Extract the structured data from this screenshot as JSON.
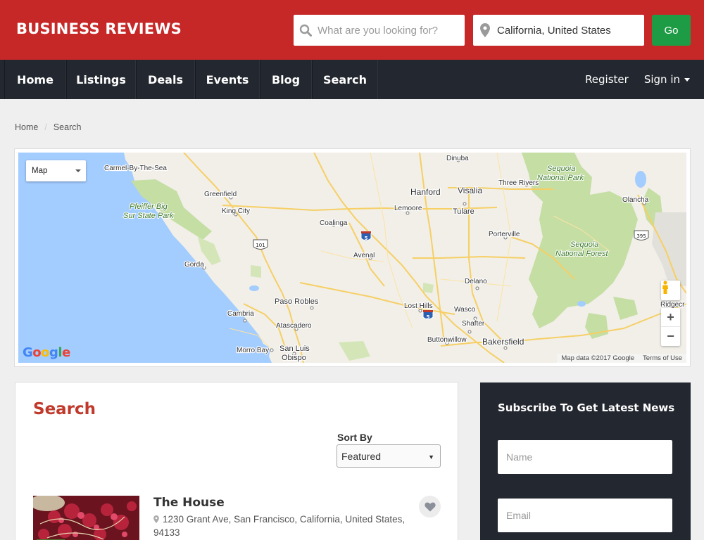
{
  "header": {
    "logo": "BUSINESS REVIEWS",
    "what_placeholder": "What are you looking for?",
    "where_value": "California, United States",
    "go_label": "Go",
    "brand_color": "#c62828",
    "go_color": "#1e9b45"
  },
  "nav": {
    "items": [
      {
        "label": "Home"
      },
      {
        "label": "Listings"
      },
      {
        "label": "Deals"
      },
      {
        "label": "Events"
      },
      {
        "label": "Blog"
      },
      {
        "label": "Search"
      }
    ],
    "register": "Register",
    "signin": "Sign in"
  },
  "breadcrumb": {
    "home": "Home",
    "current": "Search"
  },
  "map": {
    "type_label": "Map",
    "places": {
      "carmel": "Carmel-By-The-Sea",
      "dinuba": "Dinuba",
      "sequoia_np": "Sequoia",
      "sequoia_np2": "National Park",
      "three_rivers": "Three Rivers",
      "greenfield": "Greenfield",
      "hanford": "Hanford",
      "visalia": "Visalia",
      "pfeiffer1": "Pfeiffer Big",
      "pfeiffer2": "Sur State Park",
      "king_city": "King City",
      "lemoore": "Lemoore",
      "tulare": "Tulare",
      "olancha": "Olancha",
      "coalinga": "Coalinga",
      "porterville": "Porterville",
      "sequoia_nf": "Sequoia",
      "sequoia_nf2": "National Forest",
      "avenal": "Avenal",
      "gorda": "Gorda",
      "delano": "Delano",
      "ridgecrest": "Ridgecr",
      "paso_robles": "Paso Robles",
      "lost_hills": "Lost Hills",
      "cambria": "Cambria",
      "wasco": "Wasco",
      "atascadero": "Atascadero",
      "shafter": "Shafter",
      "buttonwillow": "Buttonwillow",
      "bakersfield": "Bakersfield",
      "morro_bay": "Morro Bay",
      "san_luis1": "San Luis",
      "san_luis2": "Obispo"
    },
    "shields": {
      "i5": "5",
      "us101": "101",
      "us395": "395"
    },
    "google": [
      "G",
      "o",
      "o",
      "g",
      "l",
      "e"
    ],
    "attribution": "Map data ©2017 Google",
    "terms": "Terms of Use",
    "zoom_in": "+",
    "zoom_out": "−"
  },
  "search": {
    "title": "Search",
    "sort_label": "Sort By",
    "sort_value": "Featured",
    "listing": {
      "title": "The House",
      "address": "1230 Grant Ave, San Francisco, California, United States, 94133"
    },
    "title_color": "#c0392b"
  },
  "subscribe": {
    "title": "Subscribe To Get Latest News",
    "name_placeholder": "Name",
    "email_placeholder": "Email"
  },
  "icons": [
    "search-icon",
    "location-pin-icon",
    "caret-down-icon",
    "pegman-icon",
    "map-pin-icon",
    "heart-icon"
  ]
}
